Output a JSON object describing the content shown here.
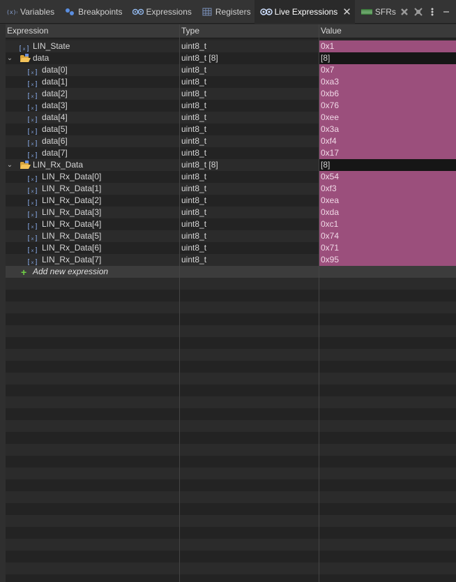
{
  "tabs": [
    {
      "name": "variables-tab",
      "icon": "variables-icon",
      "label": "Variables",
      "active": false
    },
    {
      "name": "breakpoints-tab",
      "icon": "breakpoints-icon",
      "label": "Breakpoints",
      "active": false
    },
    {
      "name": "expressions-tab",
      "icon": "expressions-icon",
      "label": "Expressions",
      "active": false
    },
    {
      "name": "registers-tab",
      "icon": "registers-icon",
      "label": "Registers",
      "active": false
    },
    {
      "name": "live-expressions-tab",
      "icon": "live-expressions-icon",
      "label": "Live Expressions",
      "active": true
    },
    {
      "name": "sfrs-tab",
      "icon": "sfrs-icon",
      "label": "SFRs",
      "active": false
    }
  ],
  "toolbar_icons": [
    "remove-all-icon",
    "refresh-icon",
    "view-menu-icon",
    "minimize-icon",
    "maximize-icon"
  ],
  "columns": {
    "expression": "Expression",
    "type": "Type",
    "value": "Value"
  },
  "rows": [
    {
      "level": 0,
      "kind": "var",
      "expr": "LIN_State",
      "type": "uint8_t",
      "value": "0x1",
      "highlight": true
    },
    {
      "level": 0,
      "kind": "array",
      "expanded": true,
      "expr": "data",
      "type": "uint8_t [8]",
      "value": "[8]",
      "highlight": false
    },
    {
      "level": 1,
      "kind": "var",
      "expr": "data[0]",
      "type": "uint8_t",
      "value": "0x7",
      "highlight": true
    },
    {
      "level": 1,
      "kind": "var",
      "expr": "data[1]",
      "type": "uint8_t",
      "value": "0xa3",
      "highlight": true
    },
    {
      "level": 1,
      "kind": "var",
      "expr": "data[2]",
      "type": "uint8_t",
      "value": "0xb6",
      "highlight": true
    },
    {
      "level": 1,
      "kind": "var",
      "expr": "data[3]",
      "type": "uint8_t",
      "value": "0x76",
      "highlight": true
    },
    {
      "level": 1,
      "kind": "var",
      "expr": "data[4]",
      "type": "uint8_t",
      "value": "0xee",
      "highlight": true
    },
    {
      "level": 1,
      "kind": "var",
      "expr": "data[5]",
      "type": "uint8_t",
      "value": "0x3a",
      "highlight": true
    },
    {
      "level": 1,
      "kind": "var",
      "expr": "data[6]",
      "type": "uint8_t",
      "value": "0xf4",
      "highlight": true
    },
    {
      "level": 1,
      "kind": "var",
      "expr": "data[7]",
      "type": "uint8_t",
      "value": "0x17",
      "highlight": true
    },
    {
      "level": 0,
      "kind": "array",
      "expanded": true,
      "expr": "LIN_Rx_Data",
      "type": "uint8_t [8]",
      "value": "[8]",
      "highlight": false
    },
    {
      "level": 1,
      "kind": "var",
      "expr": "LIN_Rx_Data[0]",
      "type": "uint8_t",
      "value": "0x54",
      "highlight": true
    },
    {
      "level": 1,
      "kind": "var",
      "expr": "LIN_Rx_Data[1]",
      "type": "uint8_t",
      "value": "0xf3",
      "highlight": true
    },
    {
      "level": 1,
      "kind": "var",
      "expr": "LIN_Rx_Data[2]",
      "type": "uint8_t",
      "value": "0xea",
      "highlight": true
    },
    {
      "level": 1,
      "kind": "var",
      "expr": "LIN_Rx_Data[3]",
      "type": "uint8_t",
      "value": "0xda",
      "highlight": true
    },
    {
      "level": 1,
      "kind": "var",
      "expr": "LIN_Rx_Data[4]",
      "type": "uint8_t",
      "value": "0xc1",
      "highlight": true
    },
    {
      "level": 1,
      "kind": "var",
      "expr": "LIN_Rx_Data[5]",
      "type": "uint8_t",
      "value": "0x74",
      "highlight": true
    },
    {
      "level": 1,
      "kind": "var",
      "expr": "LIN_Rx_Data[6]",
      "type": "uint8_t",
      "value": "0x71",
      "highlight": true
    },
    {
      "level": 1,
      "kind": "var",
      "expr": "LIN_Rx_Data[7]",
      "type": "uint8_t",
      "value": "0x95",
      "highlight": true
    }
  ],
  "add_expression": {
    "label": "Add new expression",
    "icon": "plus-icon"
  },
  "colors": {
    "changed_value": "#9b4f7c",
    "accent_green": "#6fcf45"
  }
}
